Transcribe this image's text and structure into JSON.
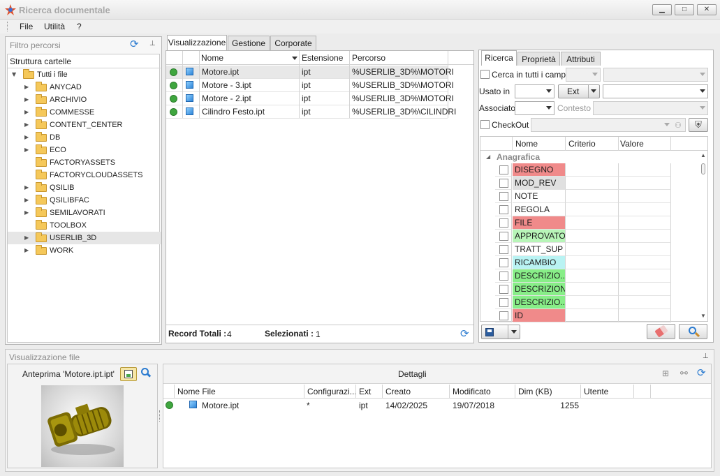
{
  "window": {
    "title": "Ricerca documentale",
    "minimize": "▁",
    "maximize": "□",
    "close": "✕"
  },
  "menu": [
    "File",
    "Utilità",
    "?"
  ],
  "left_panel": {
    "title": "Filtro percorsi",
    "tree_header": "Struttura cartelle",
    "root": "Tutti i file",
    "folders": [
      "ANYCAD",
      "ARCHIVIO",
      "COMMESSE",
      "CONTENT_CENTER",
      "DB",
      "ECO",
      "FACTORYASSETS",
      "FACTORYCLOUDASSETS",
      "QSILIB",
      "QSILIBFAC",
      "SEMILAVORATI",
      "TOOLBOX",
      "USERLIB_3D",
      "WORK"
    ],
    "expandable": [
      true,
      true,
      true,
      true,
      true,
      true,
      false,
      false,
      true,
      true,
      true,
      false,
      true,
      true
    ],
    "selected_folder": "USERLIB_3D"
  },
  "center": {
    "tabs": [
      "Visualizzazione",
      "Gestione",
      "Corporate"
    ],
    "columns": [
      "Nome",
      "Estensione",
      "Percorso"
    ],
    "rows": [
      {
        "name": "Motore.ipt",
        "ext": "ipt",
        "path": "%USERLIB_3D%\\MOTORI"
      },
      {
        "name": "Motore - 3.ipt",
        "ext": "ipt",
        "path": "%USERLIB_3D%\\MOTORI"
      },
      {
        "name": "Motore - 2.ipt",
        "ext": "ipt",
        "path": "%USERLIB_3D%\\MOTORI"
      },
      {
        "name": "Cilindro Festo.ipt",
        "ext": "ipt",
        "path": "%USERLIB_3D%\\CILINDRI"
      }
    ],
    "footer": {
      "total_label": "Record Totali :",
      "total": "4",
      "selected_label": "Selezionati :",
      "selected": "1"
    }
  },
  "right": {
    "tabs": [
      "Ricerca",
      "Proprietà",
      "Attributi"
    ],
    "search_all_label": "Cerca in tutti i campi",
    "used_in_label": "Usato in",
    "ext_button": "Ext",
    "associated_label": "Associato",
    "context_label": "Contesto",
    "checkout_label": "CheckOut",
    "grid_columns": [
      "Nome",
      "Criterio",
      "Valore"
    ],
    "group": "Anagrafica",
    "properties": [
      {
        "name": "DISEGNO",
        "color": "#f08a8a"
      },
      {
        "name": "MOD_REV",
        "color": "#e0e0e0"
      },
      {
        "name": "NOTE",
        "color": "#ffffff"
      },
      {
        "name": "REGOLA",
        "color": "#ffffff"
      },
      {
        "name": "FILE",
        "color": "#f08a8a"
      },
      {
        "name": "APPROVATO",
        "color": "#b8f5b8"
      },
      {
        "name": "TRATT_SUP",
        "color": "#ffffff"
      },
      {
        "name": "RICAMBIO",
        "color": "#b9f3f3"
      },
      {
        "name": "DESCRIZIO...",
        "color": "#88ee88"
      },
      {
        "name": "DESCRIZIONE",
        "color": "#88ee88"
      },
      {
        "name": "DESCRIZIO...",
        "color": "#88ee88"
      },
      {
        "name": "ID",
        "color": "#f08a8a"
      }
    ]
  },
  "bottom": {
    "title": "Visualizzazione file",
    "preview_label": "Anteprima 'Motore.ipt.ipt'",
    "details_title": "Dettagli",
    "columns": [
      "Nome File",
      "Configurazi...",
      "Ext",
      "Creato",
      "Modificato",
      "Dim (KB)",
      "Utente"
    ],
    "row": {
      "name": "Motore.ipt",
      "config": "*",
      "ext": "ipt",
      "created": "14/02/2025",
      "modified": "19/07/2018",
      "size": "1255",
      "user": ""
    }
  }
}
